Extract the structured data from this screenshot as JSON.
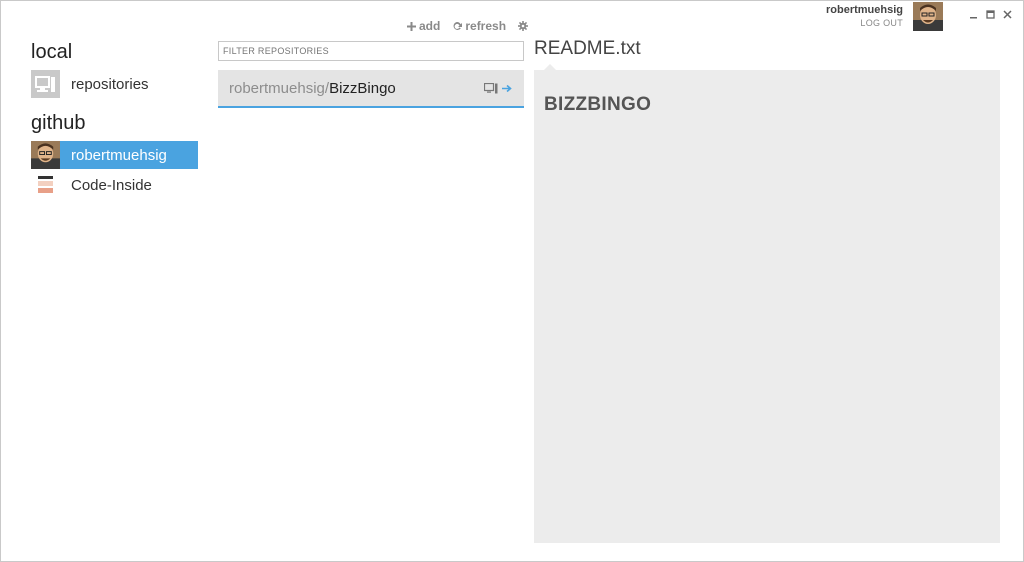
{
  "toolbar": {
    "add_label": "add",
    "refresh_label": "refresh",
    "settings_icon": "gear-icon"
  },
  "user": {
    "name": "robertmuehsig",
    "logout_label": "LOG OUT"
  },
  "sidebar": {
    "local_heading": "local",
    "local_items": [
      {
        "label": "repositories",
        "icon": "computer-icon"
      }
    ],
    "github_heading": "github",
    "github_items": [
      {
        "label": "robertmuehsig",
        "icon": "user-avatar",
        "active": true
      },
      {
        "label": "Code-Inside",
        "icon": "org-logo",
        "active": false
      }
    ]
  },
  "filter": {
    "placeholder": "FILTER REPOSITORIES"
  },
  "repositories": [
    {
      "owner": "robertmuehsig/",
      "name": "BizzBingo"
    }
  ],
  "readme": {
    "filename": "README.txt",
    "heading": "BIZZBINGO"
  },
  "colors": {
    "accent": "#4aa3e0",
    "readme_bg": "#ececec",
    "repo_bg": "#e4e4e4"
  }
}
